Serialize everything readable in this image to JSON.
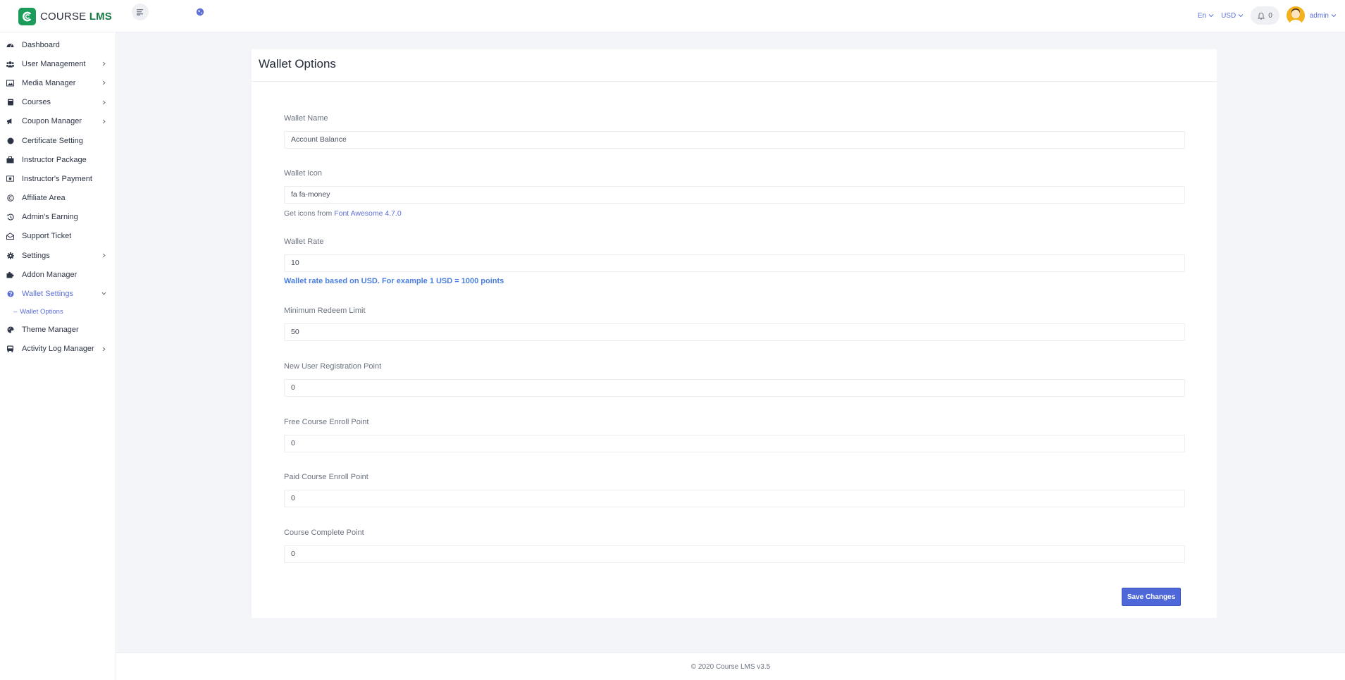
{
  "header": {
    "brand_prefix": "COURSE",
    "brand_suffix": "LMS",
    "language": "En",
    "currency": "USD",
    "notification_count": "0",
    "user_name": "admin"
  },
  "sidebar": {
    "items": [
      {
        "label": "Dashboard",
        "icon": "dashboard-icon"
      },
      {
        "label": "User Management",
        "icon": "users-icon"
      },
      {
        "label": "Media Manager",
        "icon": "image-icon"
      },
      {
        "label": "Courses",
        "icon": "book-icon"
      },
      {
        "label": "Coupon Manager",
        "icon": "bullhorn-icon"
      },
      {
        "label": "Certificate Setting",
        "icon": "certificate-icon"
      },
      {
        "label": "Instructor Package",
        "icon": "briefcase-icon"
      },
      {
        "label": "Instructor's Payment",
        "icon": "money-icon"
      },
      {
        "label": "Affiliate Area",
        "icon": "copyright-icon"
      },
      {
        "label": "Admin's Earning",
        "icon": "history-icon"
      },
      {
        "label": "Support Ticket",
        "icon": "envelope-open-icon"
      },
      {
        "label": "Settings",
        "icon": "gear-icon"
      },
      {
        "label": "Addon Manager",
        "icon": "puzzle-icon"
      },
      {
        "label": "Wallet Settings",
        "icon": "question-circle-icon"
      },
      {
        "label": "Theme Manager",
        "icon": "palette-icon"
      },
      {
        "label": "Activity Log Manager",
        "icon": "bus-icon"
      }
    ],
    "sub_item": "Wallet Options"
  },
  "page": {
    "title": "Wallet Options",
    "fields": {
      "wallet_name": {
        "label": "Wallet Name",
        "value": "Account Balance"
      },
      "wallet_icon": {
        "label": "Wallet Icon",
        "value": "fa fa-money"
      },
      "wallet_rate": {
        "label": "Wallet Rate",
        "value": "10"
      },
      "min_redeem": {
        "label": "Minimum Redeem Limit",
        "value": "50"
      },
      "new_user_point": {
        "label": "New User Registration Point",
        "value": "0"
      },
      "free_course_point": {
        "label": "Free Course Enroll Point",
        "value": "0"
      },
      "paid_course_point": {
        "label": "Paid Course Enroll Point",
        "value": "0"
      },
      "course_complete_point": {
        "label": "Course Complete Point",
        "value": "0"
      }
    },
    "icon_hint_prefix": "Get icons from",
    "icon_hint_link": "Font Awesome 4.7.0",
    "rate_note": "Wallet rate based on USD. For example 1 USD = 1000 points",
    "save_label": "Save Changes"
  },
  "footer": {
    "text": "© 2020 Course LMS v3.5"
  },
  "colors": {
    "accent": "#5d6fd8",
    "brand_green": "#1c9c5a",
    "button": "#4e68d9",
    "note_blue": "#4a7fe0"
  }
}
